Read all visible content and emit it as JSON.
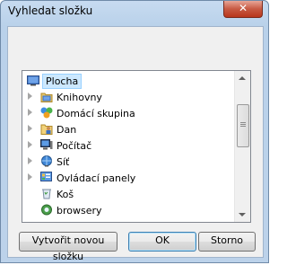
{
  "window": {
    "title": "Vyhledat složku",
    "close_label": "✕"
  },
  "tree": {
    "root_label": "Plocha",
    "items": [
      {
        "label": "Knihovny",
        "icon": "libraries-icon"
      },
      {
        "label": "Domácí skupina",
        "icon": "homegroup-icon"
      },
      {
        "label": "Dan",
        "icon": "user-folder-icon"
      },
      {
        "label": "Počítač",
        "icon": "computer-icon"
      },
      {
        "label": "Síť",
        "icon": "network-icon"
      },
      {
        "label": "Ovládací panely",
        "icon": "control-panel-icon"
      },
      {
        "label": "Koš",
        "icon": "recycle-bin-icon"
      },
      {
        "label": "browsery",
        "icon": "folder-icon"
      }
    ]
  },
  "buttons": {
    "new_folder": "Vytvořit novou složku",
    "ok": "OK",
    "cancel": "Storno"
  }
}
